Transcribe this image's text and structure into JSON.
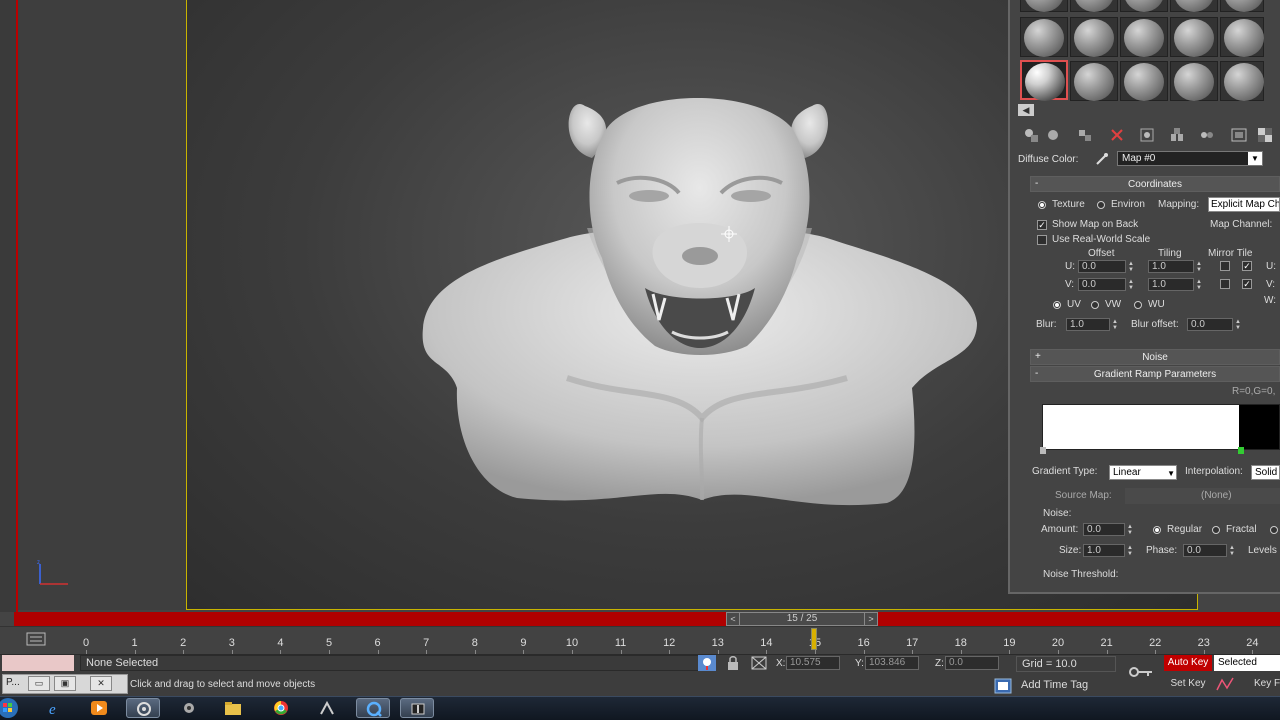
{
  "material_editor": {
    "diffuse_label": "Diffuse Color:",
    "map_select": "Map #0",
    "coordinates": {
      "title": "Coordinates",
      "texture": "Texture",
      "environ": "Environ",
      "mapping_label": "Mapping:",
      "mapping_value": "Explicit Map Ch",
      "map_channel_label": "Map Channel:",
      "show_map_on_back": "Show Map on Back",
      "use_real_world_scale": "Use Real-World Scale",
      "offset_label": "Offset",
      "tiling_label": "Tiling",
      "mirror_tile_label": "Mirror Tile",
      "u_label": "U:",
      "v_label": "V:",
      "w_label": "W:",
      "u_offset": "0.0",
      "v_offset": "0.0",
      "u_tiling": "1.0",
      "v_tiling": "1.0",
      "uv": "UV",
      "vw": "VW",
      "wu": "WU",
      "blur_label": "Blur:",
      "blur_value": "1.0",
      "blur_offset_label": "Blur offset:",
      "blur_offset_value": "0.0"
    },
    "noise_rollout_title": "Noise",
    "gradient_ramp": {
      "title": "Gradient Ramp Parameters",
      "rgb_readout": "R=0,G=0,",
      "gradient_type_label": "Gradient Type:",
      "gradient_type_value": "Linear",
      "interpolation_label": "Interpolation:",
      "interpolation_value": "Solid",
      "source_map_label": "Source Map:",
      "source_map_value": "(None)",
      "noise_group_label": "Noise:",
      "amount_label": "Amount:",
      "amount_value": "0.0",
      "regular": "Regular",
      "fractal": "Fractal",
      "size_label": "Size:",
      "size_value": "1.0",
      "phase_label": "Phase:",
      "phase_value": "0.0",
      "levels_label": "Levels",
      "noise_threshold_label": "Noise Threshold:"
    }
  },
  "timeline": {
    "frame_readout": "15 / 25",
    "prev": "<",
    "next": ">",
    "ticks": [
      "0",
      "1",
      "2",
      "3",
      "4",
      "5",
      "6",
      "7",
      "8",
      "9",
      "10",
      "11",
      "12",
      "13",
      "14",
      "15",
      "16",
      "17",
      "18",
      "19",
      "20",
      "21",
      "22",
      "23",
      "24"
    ]
  },
  "status": {
    "selection": "None Selected",
    "prompt": "Click and drag to select and move objects",
    "maxscript_label": "P...",
    "close": "✕",
    "x_label": "X:",
    "x_value": "10.575",
    "y_label": "Y:",
    "y_value": "103.846",
    "z_label": "Z:",
    "z_value": "0.0",
    "grid": "Grid = 10.0",
    "add_time_tag": "Add Time Tag",
    "auto_key": "Auto Key",
    "selected": "Selected",
    "set_key": "Set Key",
    "key_filters": "Key F"
  },
  "colors": {
    "accent_red": "#c00000",
    "viewport_border": "#c8b400"
  }
}
